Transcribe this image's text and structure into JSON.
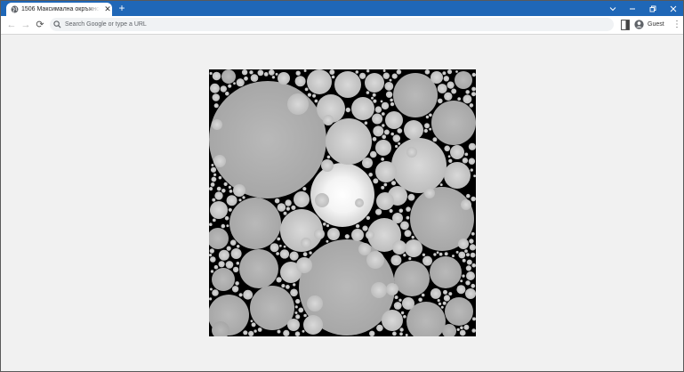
{
  "tab": {
    "title": "1506 Максимална окръжност.html",
    "close_glyph": "✕"
  },
  "new_tab_glyph": "+",
  "window_controls": {
    "dropdown": "⌄",
    "minimize": "–",
    "restore": "❐",
    "close": "✕"
  },
  "nav": {
    "back": "←",
    "forward": "→",
    "reload": "⟳"
  },
  "omnibox": {
    "placeholder": "Search Google or type a URL"
  },
  "profile": {
    "label": "Guest"
  },
  "menu_glyph": "⋮",
  "colors": {
    "titlebar": "#1f67b7",
    "page_bg": "#f1f1f1",
    "canvas_bg": "#000000"
  },
  "icons": [
    "globe-icon",
    "close-icon",
    "plus-icon",
    "chevron-down-icon",
    "minimize-icon",
    "restore-icon",
    "back-arrow-icon",
    "forward-arrow-icon",
    "reload-icon",
    "search-icon",
    "side-panel-icon",
    "profile-icon",
    "kebab-menu-icon"
  ]
}
